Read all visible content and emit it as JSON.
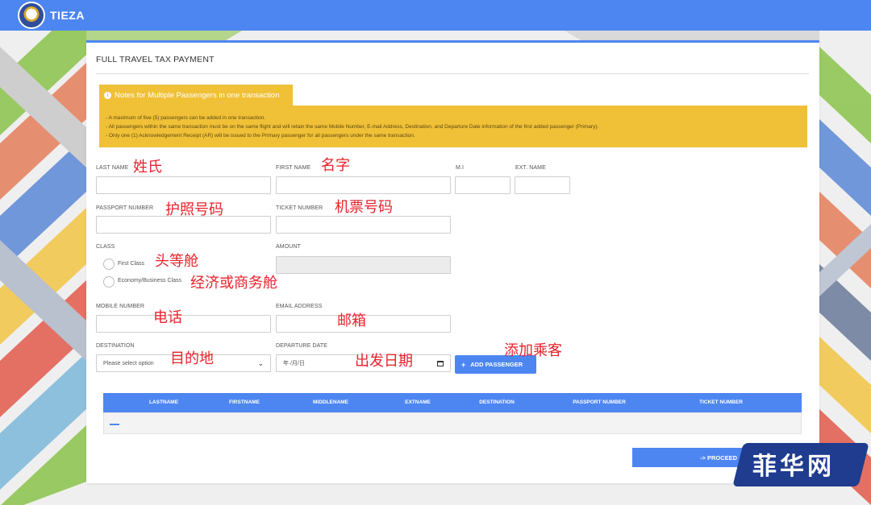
{
  "app": {
    "brand": "TIEZA"
  },
  "page": {
    "title": "FULL TRAVEL TAX PAYMENT"
  },
  "notes": {
    "heading": "Notes for Multiple Passengers in one transaction",
    "lines": [
      "- A maximum of five (5) passengers can be added in one transaction.",
      "- All passengers within the same transaction must be on the same flight and will retain the same Mobile Number, E-mail Address, Destination, and Departure Date information of the first added passenger (Primary).",
      "- Only one (1) Acknowledgement Receipt (AR) will be issued to the Primary passenger for all passengers under the same transaction."
    ]
  },
  "form": {
    "last_name_label": "LAST NAME",
    "first_name_label": "FIRST NAME",
    "mi_label": "M.I",
    "ext_name_label": "EXT. NAME",
    "passport_label": "PASSPORT NUMBER",
    "ticket_label": "TICKET NUMBER",
    "class_label": "CLASS",
    "class_options": [
      "First Class",
      "Economy/Business Class"
    ],
    "amount_label": "AMOUNT",
    "mobile_label": "MOBILE NUMBER",
    "email_label": "EMAIL ADDRESS",
    "destination_label": "DESTINATION",
    "destination_value": "Please select option",
    "departure_label": "DEPARTURE DATE",
    "departure_value": "年 /月/日",
    "add_button": "ADD PASSENGER"
  },
  "table": {
    "columns": [
      "LASTNAME",
      "FIRSTNAME",
      "MIDDLENAME",
      "EXTNAME",
      "DESTINATION",
      "PASSPORT NUMBER",
      "TICKET NUMBER"
    ]
  },
  "proceed_button": "-> PROCEED",
  "annotations": {
    "last_name": "姓氏",
    "first_name": "名字",
    "passport": "护照号码",
    "ticket": "机票号码",
    "first_class": "头等舱",
    "economy": "经济或商务舱",
    "mobile": "电话",
    "email": "邮箱",
    "destination": "目的地",
    "departure": "出发日期",
    "add_passenger": "添加乘客"
  },
  "watermark": "菲华网",
  "colors": {
    "primary": "#4d86f1",
    "notice": "#f0c037",
    "annotation": "#e8222b"
  }
}
